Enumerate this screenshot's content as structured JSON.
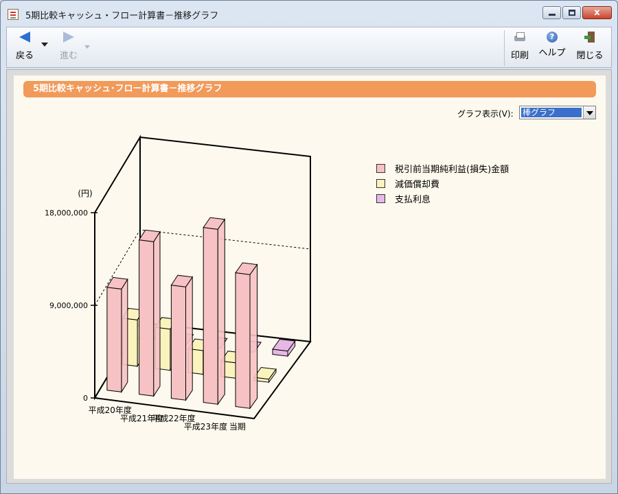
{
  "window": {
    "title": "5期比較キャッシュ・フロー計算書－推移グラフ",
    "close_glyph": "x"
  },
  "toolbar": {
    "back_label": "戻る",
    "forward_label": "進む",
    "print_label": "印刷",
    "help_label": "ヘルプ",
    "close_label": "閉じる"
  },
  "panel": {
    "heading": "5期比較キャッシュ･フロー計算書－推移グラフ",
    "graph_type_label": "グラフ表示(V):",
    "graph_type_value": "棒グラフ"
  },
  "colors": {
    "series_1": "#f7c2c4",
    "series_2": "#fbf3bd",
    "series_3": "#e7b7e6",
    "heading_bg": "#f19a5a"
  },
  "chart_data": {
    "type": "bar",
    "unit_label": "(円)",
    "categories": [
      "平成20年度",
      "平成21年度",
      "平成22年度",
      "平成23年度",
      "当期"
    ],
    "series": [
      {
        "name": "税引前当期純利益(損失)金額",
        "values": [
          10000000,
          15000000,
          11000000,
          17000000,
          13000000
        ]
      },
      {
        "name": "減価償却費",
        "values": [
          4500000,
          4000000,
          2300000,
          1500000,
          300000
        ]
      },
      {
        "name": "支払利息",
        "values": [
          0,
          0,
          0,
          0,
          500000
        ]
      }
    ],
    "y_ticks": [
      "18,000,000",
      "9,000,000",
      "0"
    ],
    "ylim": [
      0,
      18000000
    ],
    "grid": true,
    "legend_position": "right"
  }
}
